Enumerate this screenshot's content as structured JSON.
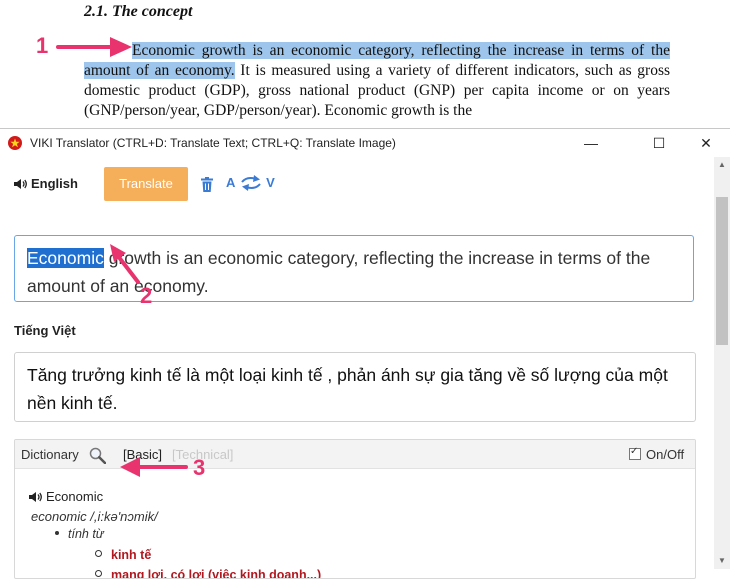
{
  "document": {
    "heading": "2.1. The concept",
    "highlighted_text": "Economic growth is an economic category, reflecting the increase in terms of the amount of an economy.",
    "body_text": " It is measured using a variety of different indicators, such as gross domestic product (GDP), gross national product (GNP) per capita income or on years (GNP/person/year, GDP/person/year). Economic growth is the"
  },
  "annotations": {
    "one": "1",
    "two": "2",
    "three": "3"
  },
  "window": {
    "title": "VIKI Translator (CTRL+D: Translate Text; CTRL+Q: Translate Image)",
    "minimize": "—",
    "maximize": "☐",
    "close": "✕"
  },
  "toolbar": {
    "source_language": "English",
    "translate_label": "Translate",
    "swap_from": "A",
    "swap_to": "V"
  },
  "source": {
    "selected_word": "Economic",
    "rest_text": " growth is an economic category, reflecting the increase in terms of the amount of an economy."
  },
  "target": {
    "language": "Tiếng Việt",
    "text": "Tăng trưởng kinh tế là một loại kinh tế , phản ánh sự gia tăng về số lượng của một nền kinh tế."
  },
  "dictionary": {
    "label": "Dictionary",
    "tab_basic": "[Basic]",
    "tab_technical": "[Technical]",
    "onoff_label": "On/Off",
    "entry": {
      "word": "Economic",
      "pronunciation": "economic /,i:kə'nɔmik/",
      "part_of_speech": "tính từ",
      "senses": [
        "kinh tế",
        "mang lợi, có lợi (việc kinh doanh...)"
      ]
    }
  },
  "colors": {
    "accent_button": "#f5ae5a",
    "selection": "#1f6fd1",
    "annotation": "#e8336f",
    "sense_text": "#b0171f"
  }
}
